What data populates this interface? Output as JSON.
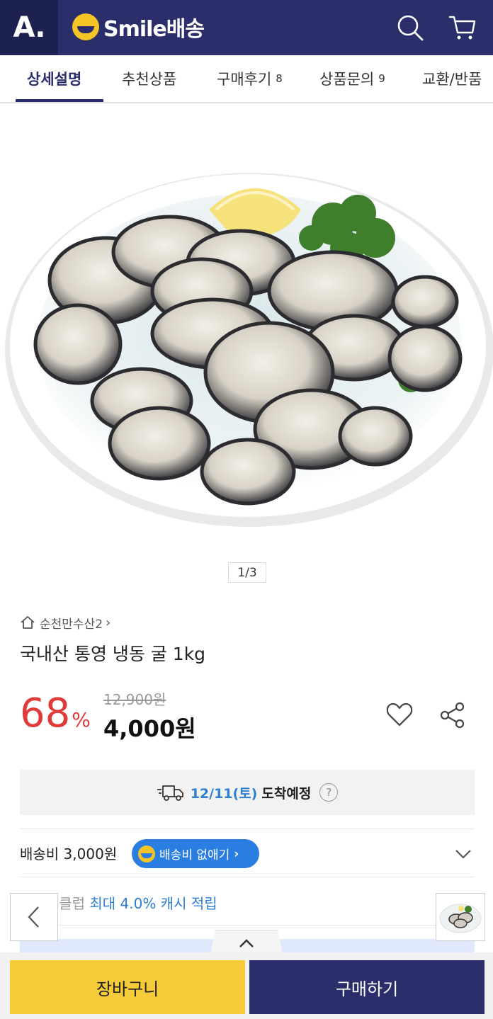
{
  "header": {
    "logo_letter": "A.",
    "service_name": "Smile배송"
  },
  "tabs": [
    {
      "label": "상세설명",
      "count": ""
    },
    {
      "label": "추천상품",
      "count": ""
    },
    {
      "label": "구매후기",
      "count": "8"
    },
    {
      "label": "상품문의",
      "count": "9"
    },
    {
      "label": "교환/반품",
      "count": ""
    }
  ],
  "gallery": {
    "indicator": "1/3"
  },
  "product": {
    "seller": "순천만수산2",
    "title": "국내산 통영 냉동 굴 1kg",
    "discount": "68",
    "discount_unit": "%",
    "original_price": "12,900원",
    "sale_price": "4,000원"
  },
  "delivery": {
    "date": "12/11(토)",
    "label": "도착예정",
    "help": "?"
  },
  "shipping": {
    "fee_text": "배송비 3,000원",
    "badge": "배송비 없애기"
  },
  "club": {
    "prefix": "스마일클럽",
    "highlight": "최대 4.0% 캐시 적립"
  },
  "actions": {
    "cart": "장바구니",
    "buy": "구매하기"
  },
  "colors": {
    "brand_navy": "#2a2f6b",
    "smile_yellow": "#f5c425",
    "discount_red": "#e03b3b",
    "accent_blue": "#2e7fd1",
    "cart_yellow": "#f5cb3a"
  }
}
